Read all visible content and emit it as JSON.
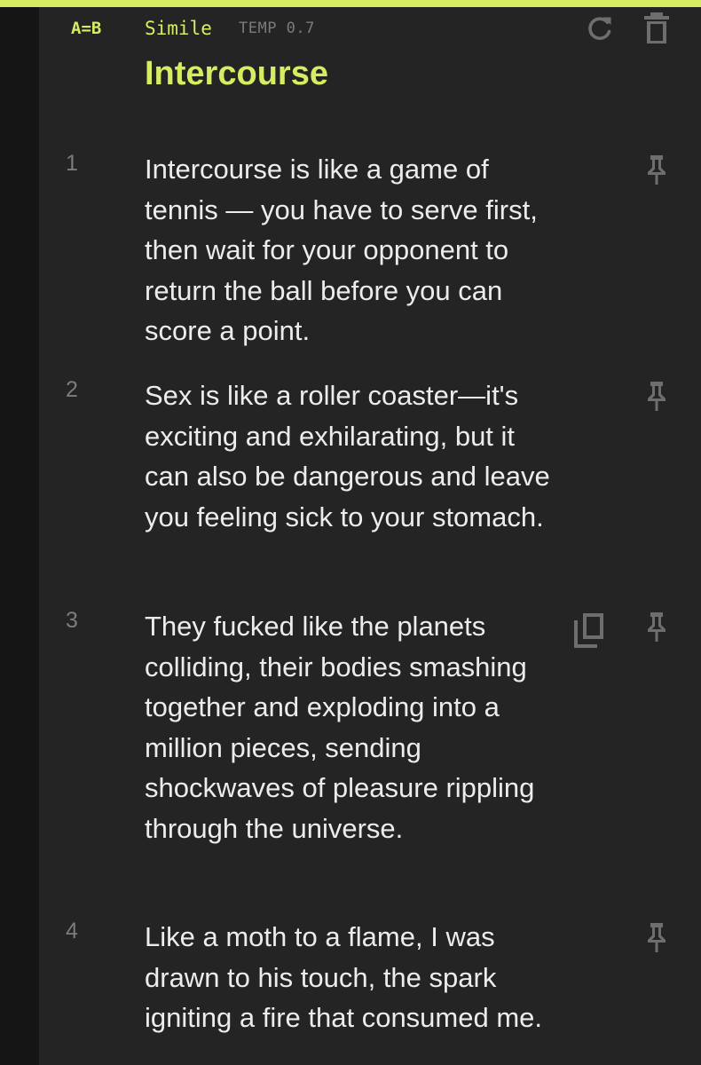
{
  "header": {
    "badge": "A=B",
    "mode": "Simile",
    "temp": "TEMP 0.7",
    "refresh_icon": "refresh-icon",
    "delete_icon": "trash-icon"
  },
  "title": "Intercourse",
  "colors": {
    "accent": "#d8ec62",
    "background": "#242424",
    "text": "#ececec",
    "muted": "#7c7c7c"
  },
  "items": [
    {
      "num": "1",
      "text": "Intercourse is like a game of tennis — you have to serve first, then wait for your opponent to return the ball before you can score a point.",
      "pin_icon": "pin-icon"
    },
    {
      "num": "2",
      "text": "Sex is like a roller coaster—it's exciting and exhilarating, but it can also be dangerous and leave you feeling sick to your stomach.",
      "pin_icon": "pin-icon"
    },
    {
      "num": "3",
      "text": "They fucked like the planets colliding, their bodies smashing together and exploding into a million pieces, sending shockwaves of pleasure rippling through the universe.",
      "pin_icon": "pin-icon",
      "copy_icon": "copy-icon"
    },
    {
      "num": "4",
      "text": "Like a moth to a flame, I was drawn to his touch, the spark igniting a fire that consumed me.",
      "pin_icon": "pin-icon"
    }
  ]
}
